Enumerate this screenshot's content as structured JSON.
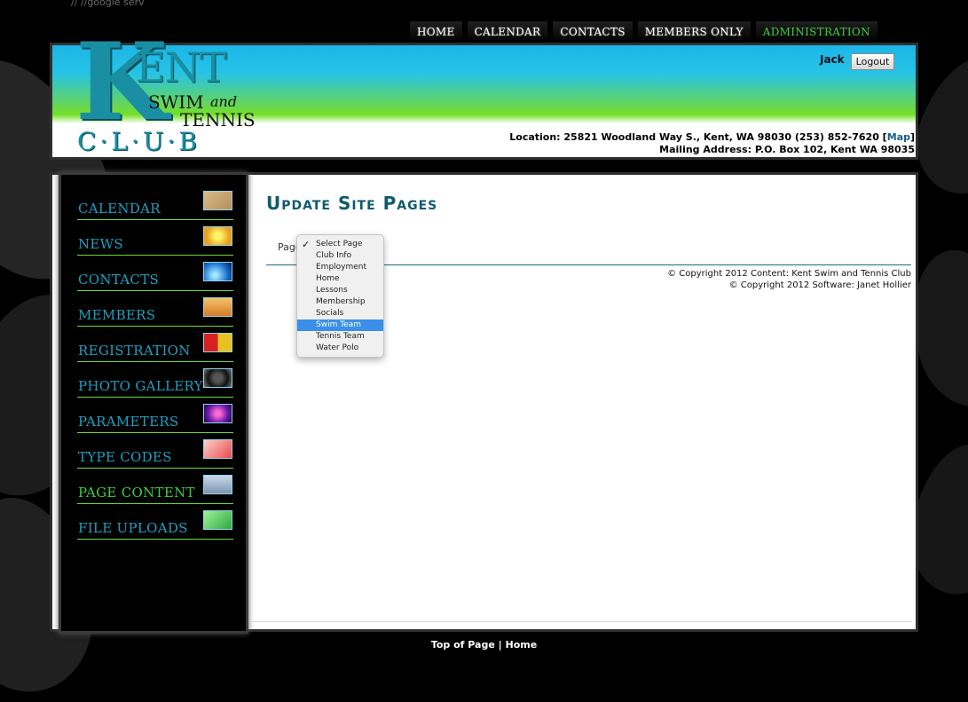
{
  "top_snippet": "// //google serv",
  "top_nav": {
    "items": [
      "HOME",
      "CALENDAR",
      "CONTACTS",
      "MEMBERS ONLY",
      "ADMINISTRATION"
    ],
    "active": "ADMINISTRATION",
    "active_color": "#3fcf3f"
  },
  "header": {
    "logo": {
      "k": "K",
      "ent": "ENT",
      "swim": "SWIM",
      "and": "and",
      "tennis": "TENNIS",
      "club": "C·L·U·B"
    },
    "user": "Jack",
    "logout_label": "Logout",
    "location": "Location: 25821 Woodland Way S., Kent, WA 98030 (253) 852-7620 [",
    "map_label": "Map",
    "location_end": "]",
    "mailing": "Mailing Address: P.O. Box 102, Kent WA 98035"
  },
  "sidebar": {
    "items": [
      {
        "label": "CALENDAR",
        "icon": "calendar-thumbnail-icon"
      },
      {
        "label": "NEWS",
        "icon": "news-thumbnail-icon"
      },
      {
        "label": "CONTACTS",
        "icon": "contacts-thumbnail-icon"
      },
      {
        "label": "MEMBERS",
        "icon": "members-thumbnail-icon"
      },
      {
        "label": "REGISTRATION",
        "icon": "registration-thumbnail-icon"
      },
      {
        "label": "PHOTO GALLERY",
        "icon": "camera-thumbnail-icon"
      },
      {
        "label": "PARAMETERS",
        "icon": "parameters-thumbnail-icon"
      },
      {
        "label": "TYPE CODES",
        "icon": "type-codes-thumbnail-icon"
      },
      {
        "label": "PAGE CONTENT",
        "icon": "page-content-thumbnail-icon"
      },
      {
        "label": "FILE UPLOADS",
        "icon": "file-uploads-thumbnail-icon"
      }
    ],
    "active": "PAGE CONTENT",
    "label_color": "#1ea0c0"
  },
  "main": {
    "title": "Update Site Pages",
    "page_label": "Page",
    "title_color": "#0f5a6e"
  },
  "page_select": {
    "options": [
      "Select Page",
      "Club Info",
      "Employment",
      "Home",
      "Lessons",
      "Membership",
      "Socials",
      "Swim Team",
      "Tennis Team",
      "Water Polo"
    ],
    "checked": "Select Page",
    "highlighted": "Swim Team",
    "highlight_color": "#3a8fe8"
  },
  "copyright": {
    "content": "© Copyright 2012 Content: Kent Swim and Tennis Club",
    "software": "© Copyright 2012 Software: Janet Hollier"
  },
  "footer": {
    "top_of_page": "Top of Page",
    "separator": "|",
    "home": "Home"
  }
}
